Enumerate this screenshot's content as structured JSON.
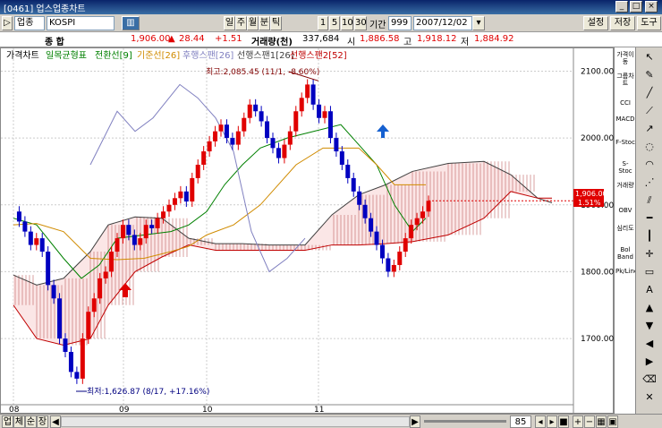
{
  "window": {
    "title": "[0461] 업스업종차트"
  },
  "toolbar": {
    "market_type": "업종",
    "index_code": "KOSPI",
    "period_buttons": [
      "일",
      "주",
      "월",
      "분",
      "틱"
    ],
    "interval_buttons": [
      "1",
      "5",
      "10",
      "30"
    ],
    "period_label": "기간",
    "period_count": "999",
    "date": "2007/12/02",
    "settings_label": "설정",
    "save_label": "저장",
    "tools_label": "도구"
  },
  "info": {
    "name": "종   합",
    "price": "1,906.00",
    "change_arrow": "▲",
    "change": "28.44",
    "change_pct": "+1.51",
    "volume_label": "거래량(천)",
    "volume": "337,684",
    "open_label": "시",
    "open": "1,886.58",
    "high_label": "고",
    "high": "1,918.12",
    "low_label": "저",
    "low": "1,884.92"
  },
  "legend": {
    "chart_label": "가격차트",
    "indicator": "일목균형표",
    "lines": [
      {
        "label": "전환선[9]",
        "color": "#008000"
      },
      {
        "label": "기준선[26]",
        "color": "#d08b00"
      },
      {
        "label": "후행스팬[26]",
        "color": "#8080c0"
      },
      {
        "label": "선행스팬1[26]",
        "color": "#404040"
      },
      {
        "label": "선행스팬2[52]",
        "color": "#c00000"
      }
    ]
  },
  "annotations": {
    "high": "최고:2,085.45 (11/1, -8.60%)",
    "low": "최저:1,626.87 (8/17, +17.16%)"
  },
  "price_badge": {
    "price": "1,906.00",
    "pct": "1.51%"
  },
  "right_labels": [
    "가격이동",
    "그룹차트",
    "CCI",
    "MACD",
    "F-Stoc",
    "S-Stoc",
    "거래량",
    "OBV",
    "심리도",
    "Bol Band",
    "Pk/Line"
  ],
  "bottom": {
    "tabs": [
      "업",
      "체",
      "순",
      "장"
    ],
    "count": "85"
  },
  "chart_data": {
    "type": "candlestick",
    "x_tick_labels": [
      "08",
      "09",
      "10",
      "11"
    ],
    "y_tick_labels": [
      "2100.00",
      "2000.00",
      "1900.00",
      "1800.00",
      "1700.00"
    ],
    "y_ticks": [
      2100,
      2000,
      1900,
      1800,
      1700
    ],
    "ylim": [
      1605,
      2110
    ],
    "up_color": "#e00000",
    "down_color": "#0000c0",
    "high_value": 2085.45,
    "low_value": 1626.87,
    "current_value": 1906.0
  }
}
